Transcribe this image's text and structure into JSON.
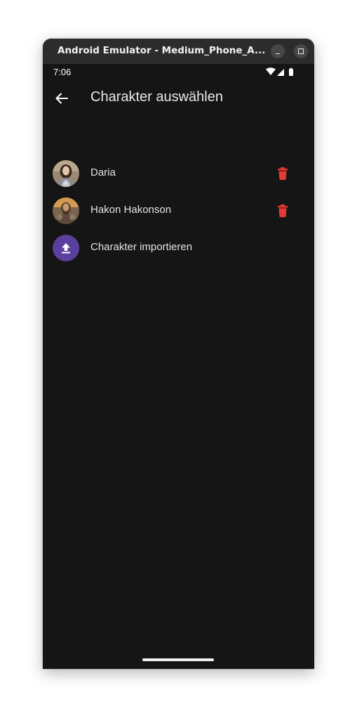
{
  "window": {
    "title": "Android Emulator - Medium_Phone_A..."
  },
  "statusbar": {
    "time": "7:06",
    "icons": [
      "wifi-icon",
      "cell-signal-icon",
      "battery-icon"
    ]
  },
  "appbar": {
    "back_icon": "arrow-back-icon",
    "title": "Charakter auswählen"
  },
  "characters": [
    {
      "name": "Daria",
      "avatar": "portrait of a woman in armor",
      "action_icon": "delete-icon"
    },
    {
      "name": "Hakon Hakonson",
      "avatar": "portrait of a bearded warrior",
      "action_icon": "delete-icon"
    }
  ],
  "import": {
    "label": "Charakter importieren",
    "icon": "upload-icon"
  },
  "colors": {
    "background": "#151515",
    "delete": "#e53935",
    "import_accent": "#5a3f9d",
    "text": "#e4e4e4"
  }
}
